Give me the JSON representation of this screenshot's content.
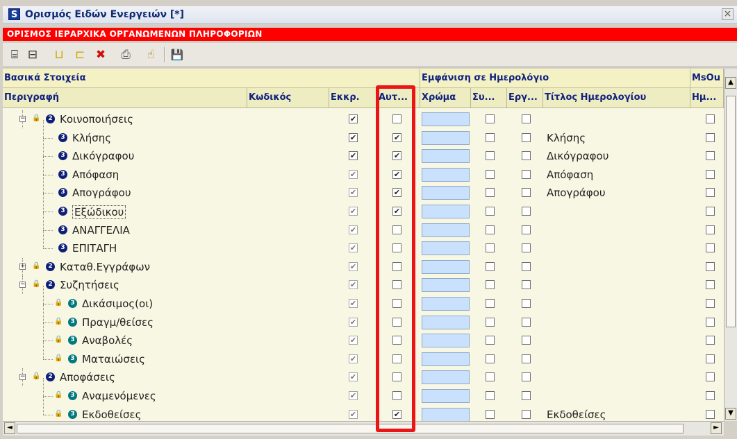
{
  "window": {
    "app_icon_letter": "S",
    "title": "Ορισμός Ειδών Ενεργειών [*]",
    "close_glyph": "×"
  },
  "banner": {
    "text": "ΟΡΙΣΜΟΣ ΙΕΡΑΡΧΙΚΑ ΟΡΓΑΝΩΜΕΝΩΝ ΠΛΗΡΟΦΟΡΙΩΝ"
  },
  "toolbar": {
    "buttons": [
      {
        "name": "tree-expand-icon",
        "glyph": "⌸"
      },
      {
        "name": "tree-collapse-icon",
        "glyph": "⊟"
      },
      {
        "name": "insert-sibling-icon",
        "glyph": "⊔"
      },
      {
        "name": "insert-child-icon",
        "glyph": "⊏"
      },
      {
        "name": "delete-icon",
        "glyph": "✖"
      },
      {
        "name": "print-icon",
        "glyph": "⎙"
      },
      {
        "name": "help-icon",
        "glyph": "☝"
      },
      {
        "name": "save-icon",
        "glyph": "💾"
      }
    ]
  },
  "grid": {
    "groups": {
      "basic": "Βασικά Στοιχεία",
      "calendar": "Εμφάνιση σε Ημερολόγιο",
      "msou": "MsOu"
    },
    "columns": {
      "description": "Περιγραφή",
      "code": "Κωδικός",
      "ekkr": "Εκκρ.",
      "aut": "Αυτ...",
      "color": "Χρώμα",
      "sy": "Συ...",
      "erg": "Εργ...",
      "cal_title": "Τίτλος Ημερολογίου",
      "hm": "Ημ..."
    },
    "rows": [
      {
        "label": "Κοινοποιήσεις",
        "level": 1,
        "expander": "−",
        "lock": true,
        "badge": "dark",
        "ekkr": true,
        "ekkr_dim": false,
        "aut": false,
        "cal_title": ""
      },
      {
        "label": "Κλήσης",
        "level": 2,
        "expander": "",
        "lock": false,
        "badge": "dark",
        "ekkr": true,
        "ekkr_dim": false,
        "aut": true,
        "cal_title": "Κλήσης"
      },
      {
        "label": "Δικόγραφου",
        "level": 2,
        "expander": "",
        "lock": false,
        "badge": "dark",
        "ekkr": true,
        "ekkr_dim": false,
        "aut": true,
        "cal_title": "Δικόγραφου"
      },
      {
        "label": "Απόφαση",
        "level": 2,
        "expander": "",
        "lock": false,
        "badge": "dark",
        "ekkr": true,
        "ekkr_dim": true,
        "aut": true,
        "cal_title": "Απόφαση"
      },
      {
        "label": "Απογράφου",
        "level": 2,
        "expander": "",
        "lock": false,
        "badge": "dark",
        "ekkr": true,
        "ekkr_dim": true,
        "aut": true,
        "cal_title": "Απογράφου"
      },
      {
        "label": "Εξώδικου",
        "level": 2,
        "expander": "",
        "lock": false,
        "badge": "dark",
        "ekkr": true,
        "ekkr_dim": true,
        "aut": true,
        "cal_title": "",
        "selected": true
      },
      {
        "label": "ΑΝΑΓΓΕΛΙΑ",
        "level": 2,
        "expander": "",
        "lock": false,
        "badge": "dark",
        "ekkr": true,
        "ekkr_dim": true,
        "aut": false,
        "cal_title": ""
      },
      {
        "label": "ΕΠΙΤΑΓΗ",
        "level": 2,
        "expander": "",
        "lock": false,
        "badge": "dark",
        "ekkr": true,
        "ekkr_dim": true,
        "aut": false,
        "cal_title": ""
      },
      {
        "label": "Καταθ.Εγγράφων",
        "level": 1,
        "expander": "+",
        "lock": true,
        "badge": "dark",
        "ekkr": true,
        "ekkr_dim": true,
        "aut": false,
        "cal_title": ""
      },
      {
        "label": "Συζητήσεις",
        "level": 1,
        "expander": "−",
        "lock": true,
        "badge": "dark",
        "ekkr": true,
        "ekkr_dim": true,
        "aut": false,
        "cal_title": ""
      },
      {
        "label": "Δικάσιμος(οι)",
        "level": 2,
        "expander": "",
        "lock": true,
        "badge": "teal",
        "ekkr": true,
        "ekkr_dim": true,
        "aut": false,
        "cal_title": ""
      },
      {
        "label": "Πραγμ/θείσες",
        "level": 2,
        "expander": "",
        "lock": true,
        "badge": "teal",
        "ekkr": true,
        "ekkr_dim": true,
        "aut": false,
        "cal_title": ""
      },
      {
        "label": "Αναβολές",
        "level": 2,
        "expander": "",
        "lock": true,
        "badge": "teal",
        "ekkr": true,
        "ekkr_dim": true,
        "aut": false,
        "cal_title": ""
      },
      {
        "label": "Ματαιώσεις",
        "level": 2,
        "expander": "",
        "lock": true,
        "badge": "teal",
        "ekkr": true,
        "ekkr_dim": true,
        "aut": false,
        "cal_title": ""
      },
      {
        "label": "Αποφάσεις",
        "level": 1,
        "expander": "−",
        "lock": true,
        "badge": "dark",
        "ekkr": true,
        "ekkr_dim": true,
        "aut": false,
        "cal_title": ""
      },
      {
        "label": "Αναμενόμενες",
        "level": 2,
        "expander": "",
        "lock": true,
        "badge": "teal",
        "ekkr": true,
        "ekkr_dim": true,
        "aut": false,
        "cal_title": ""
      },
      {
        "label": "Εκδοθείσες",
        "level": 2,
        "expander": "",
        "lock": true,
        "badge": "teal",
        "ekkr": true,
        "ekkr_dim": true,
        "aut": true,
        "cal_title": "Εκδοθείσες"
      }
    ]
  },
  "scroll": {
    "up": "▲",
    "down": "▼",
    "left": "◄",
    "right": "►"
  },
  "colors": {
    "banner": "#ff0000",
    "highlight": "#ea1515",
    "color_cell": "#c9e1fc"
  }
}
